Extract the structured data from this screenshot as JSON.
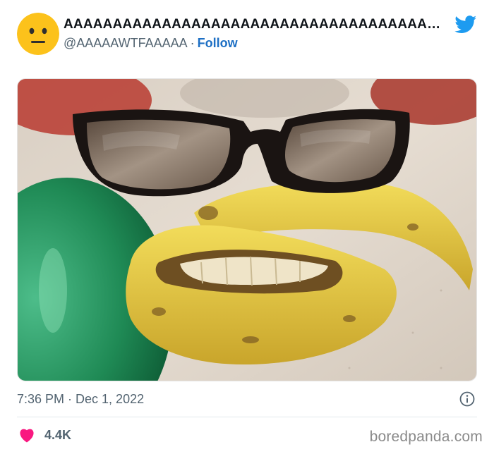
{
  "tweet": {
    "author_name": "AAAAAAAAAAAAAAAAAAAAAAAAAAAAAAAAAAAAAA...",
    "handle": "@AAAAAWTFAAAAA",
    "separator": "·",
    "follow_label": "Follow",
    "timestamp": "7:36 PM · Dec 1, 2022",
    "like_count": "4.4K"
  },
  "icons": {
    "avatar": "neutral-face-emoji",
    "brand": "twitter-bird-icon",
    "info": "info-icon",
    "like": "heart-icon"
  },
  "colors": {
    "follow": "#1d6fc4",
    "twitter_blue": "#1d9bf0",
    "heart": "#f91880",
    "muted_text": "#536471",
    "emoji_yellow": "#fcc21b"
  },
  "watermark": "boredpanda.com"
}
